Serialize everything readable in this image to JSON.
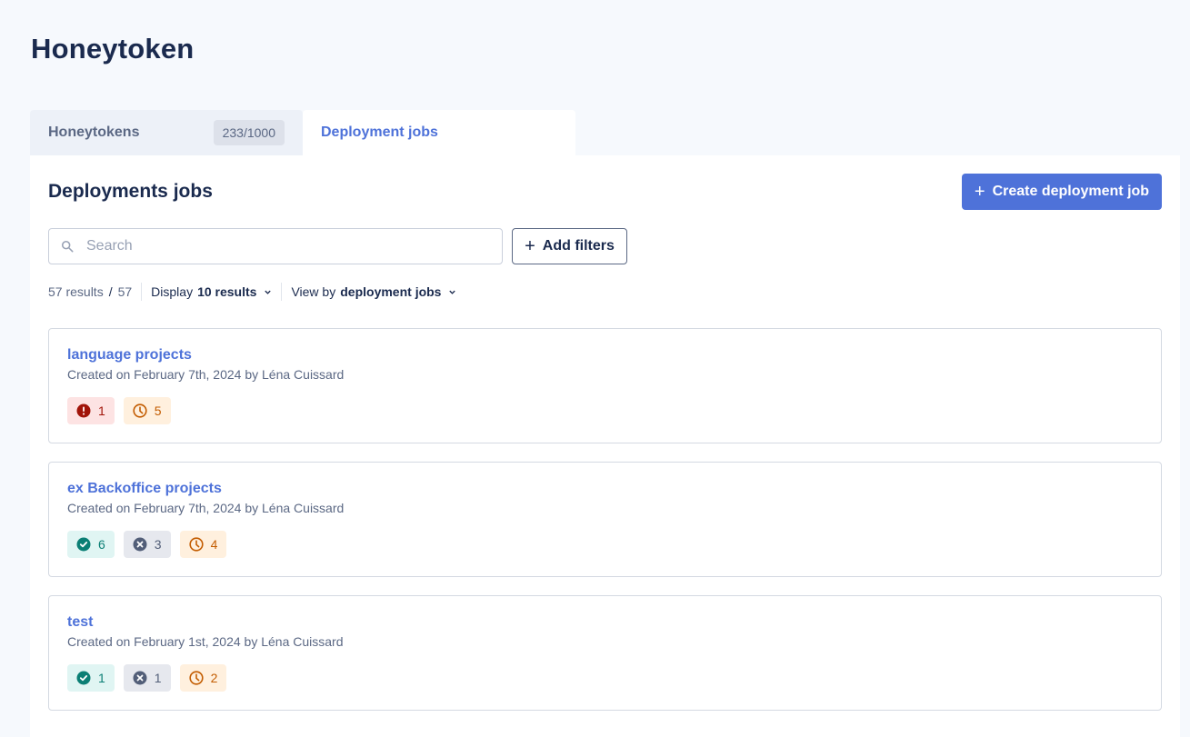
{
  "page": {
    "title": "Honeytoken"
  },
  "tabs": [
    {
      "label": "Honeytokens",
      "count": "233/1000",
      "active": false
    },
    {
      "label": "Deployment jobs",
      "active": true
    }
  ],
  "section": {
    "title": "Deployments jobs",
    "create_button": "Create deployment job"
  },
  "search": {
    "placeholder": "Search",
    "value": ""
  },
  "filters": {
    "label": "Add filters"
  },
  "toolbar": {
    "results_count": "57 results",
    "results_total": "57",
    "display_label": "Display",
    "display_value": "10 results",
    "view_label": "View by",
    "view_value": "deployment jobs"
  },
  "jobs": [
    {
      "name": "language projects",
      "meta": "Created on February 7th, 2024 by Léna Cuissard",
      "badges": [
        {
          "type": "error",
          "icon": "alert-circle-icon",
          "count": "1"
        },
        {
          "type": "pending",
          "icon": "clock-icon",
          "count": "5"
        }
      ]
    },
    {
      "name": "ex Backoffice projects",
      "meta": "Created on February 7th, 2024 by Léna Cuissard",
      "badges": [
        {
          "type": "success",
          "icon": "check-circle-icon",
          "count": "6"
        },
        {
          "type": "failed",
          "icon": "x-circle-icon",
          "count": "3"
        },
        {
          "type": "pending",
          "icon": "clock-icon",
          "count": "4"
        }
      ]
    },
    {
      "name": "test",
      "meta": "Created on February 1st, 2024 by Léna Cuissard",
      "badges": [
        {
          "type": "success",
          "icon": "check-circle-icon",
          "count": "1"
        },
        {
          "type": "failed",
          "icon": "x-circle-icon",
          "count": "1"
        },
        {
          "type": "pending",
          "icon": "clock-icon",
          "count": "2"
        }
      ]
    }
  ],
  "colors": {
    "accent": "#4e72d9",
    "error": "#a11409",
    "pending": "#c35c00",
    "success": "#0b7f75",
    "failed": "#525e78"
  }
}
